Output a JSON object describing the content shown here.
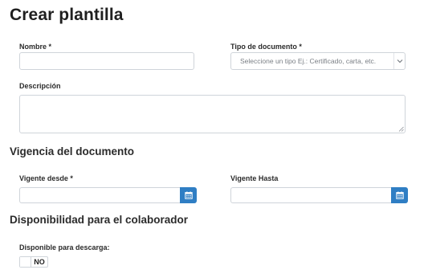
{
  "page": {
    "title": "Crear plantilla"
  },
  "form": {
    "nombre": {
      "label": "Nombre *",
      "value": ""
    },
    "tipo_documento": {
      "label": "Tipo de documento *",
      "placeholder": "Seleccione un tipo Ej.: Certificado, carta, etc.",
      "icon": "chevron-down-icon"
    },
    "descripcion": {
      "label": "Descripción",
      "value": ""
    }
  },
  "vigencia": {
    "title": "Vigencia del documento",
    "desde": {
      "label": "Vigente desde *",
      "value": "",
      "icon": "calendar-icon"
    },
    "hasta": {
      "label": "Vigente Hasta",
      "value": "",
      "icon": "calendar-icon"
    }
  },
  "disponibilidad": {
    "title": "Disponibilidad para el colaborador",
    "descarga": {
      "label": "Disponible para descarga:",
      "state": "NO"
    }
  },
  "colors": {
    "accent": "#2f7ec4",
    "border": "#cfd4da",
    "text": "#2b2b2b"
  }
}
